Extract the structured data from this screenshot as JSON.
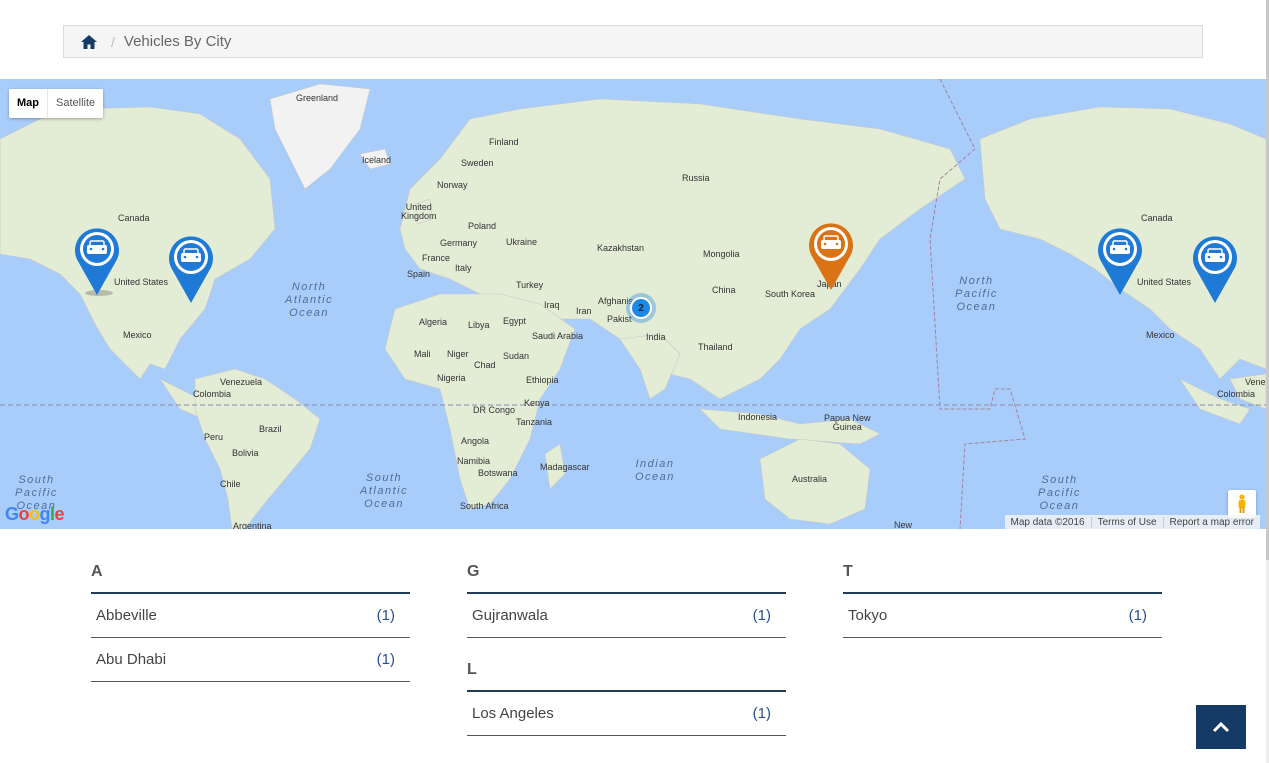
{
  "breadcrumb": {
    "home_icon": "home-icon",
    "current": "Vehicles By City"
  },
  "map": {
    "type_control": {
      "map": "Map",
      "satellite": "Satellite",
      "selected": "Map"
    },
    "labels": {
      "greenland": "Greenland",
      "iceland": "Iceland",
      "finland": "Finland",
      "sweden": "Sweden",
      "norway": "Norway",
      "russia": "Russia",
      "uk": "United\nKingdom",
      "poland": "Poland",
      "germany": "Germany",
      "ukraine": "Ukraine",
      "france": "France",
      "italy": "Italy",
      "spain": "Spain",
      "kazakhstan": "Kazakhstan",
      "mongolia": "Mongolia",
      "turkey": "Turkey",
      "iraq": "Iraq",
      "iran": "Iran",
      "afghanistan": "Afghanis",
      "pakistan": "Pakist",
      "china": "China",
      "south_korea": "South Korea",
      "japan": "Japan",
      "india": "India",
      "thailand": "Thailand",
      "algeria": "Algeria",
      "libya": "Libya",
      "egypt": "Egypt",
      "saudi": "Saudi Arabia",
      "mali": "Mali",
      "niger": "Niger",
      "sudan": "Sudan",
      "chad": "Chad",
      "nigeria": "Nigeria",
      "ethiopia": "Ethiopia",
      "drcongo": "DR Congo",
      "kenya": "Kenya",
      "tanzania": "Tanzania",
      "angola": "Angola",
      "namibia": "Namibia",
      "botswana": "Botswana",
      "madagascar": "Madagascar",
      "south_africa": "South Africa",
      "indonesia": "Indonesia",
      "png": "Papua New\nGuinea",
      "australia": "Australia",
      "new": "New",
      "canada_l": "Canada",
      "us_l": "United States",
      "mexico_l": "Mexico",
      "canada_r": "Canada",
      "us_r": "United States",
      "mexico_r": "Mexico",
      "venezuela": "Venezuela",
      "colombia": "Colombia",
      "brazil": "Brazil",
      "peru": "Peru",
      "bolivia": "Bolivia",
      "chile": "Chile",
      "argentina": "Argentina",
      "venez_r": "Vene",
      "colom_r": "Colombia"
    },
    "oceans": {
      "north_atlantic": "North\nAtlantic\nOcean",
      "north_pacific": "North\nPacific\nOcean",
      "south_atlantic": "South\nAtlantic\nOcean",
      "indian": "Indian\nOcean",
      "south_pacific_l": "South\nPacific\nOcean",
      "south_pacific_r": "South\nPacific\nOcean"
    },
    "cluster_count": "2",
    "zoom_in": "+",
    "zoom_out": "−",
    "logo": "Google",
    "attribution": [
      "Map data ©2016",
      "Terms of Use",
      "Report a map error"
    ],
    "colors": {
      "pin_blue": "#1e7ad6",
      "pin_orange": "#d97316",
      "water": "#a9cdfa",
      "land": "#e6eedb"
    }
  },
  "cities": {
    "groups": [
      {
        "letter": "A",
        "items": [
          {
            "name": "Abbeville",
            "count": "(1)"
          },
          {
            "name": "Abu Dhabi",
            "count": "(1)"
          }
        ]
      },
      {
        "letter": "G",
        "items": [
          {
            "name": "Gujranwala",
            "count": "(1)"
          }
        ]
      },
      {
        "letter": "L",
        "items": [
          {
            "name": "Los Angeles",
            "count": "(1)"
          }
        ]
      },
      {
        "letter": "T",
        "items": [
          {
            "name": "Tokyo",
            "count": "(1)"
          }
        ]
      }
    ]
  },
  "scroll_top_icon": "chevron-up-icon"
}
